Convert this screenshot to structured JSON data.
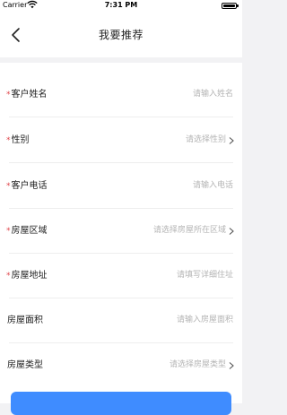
{
  "status": {
    "carrier": "Carrier",
    "time": "7:31 PM"
  },
  "header": {
    "title": "我要推荐"
  },
  "fields": [
    {
      "label": "客户姓名",
      "required": "*",
      "placeholder": "请输入姓名",
      "arrow": false
    },
    {
      "label": "性别",
      "required": "*",
      "placeholder": "请选择性别",
      "arrow": true
    },
    {
      "label": "客户电话",
      "required": "*",
      "placeholder": "请输入电话",
      "arrow": false
    },
    {
      "label": "房屋区域",
      "required": "*",
      "placeholder": "请选择房屋所在区域",
      "arrow": true
    },
    {
      "label": "房屋地址",
      "required": "*",
      "placeholder": "请填写详细住址",
      "arrow": false
    },
    {
      "label": "房屋面积",
      "required": "",
      "placeholder": "请输入房屋面积",
      "arrow": false
    },
    {
      "label": "房屋类型",
      "required": "",
      "placeholder": "请选择房屋类型",
      "arrow": true
    }
  ],
  "colors": {
    "accent": "#3f8cff",
    "required": "#e0474c",
    "placeholder": "#b4b4b4"
  }
}
